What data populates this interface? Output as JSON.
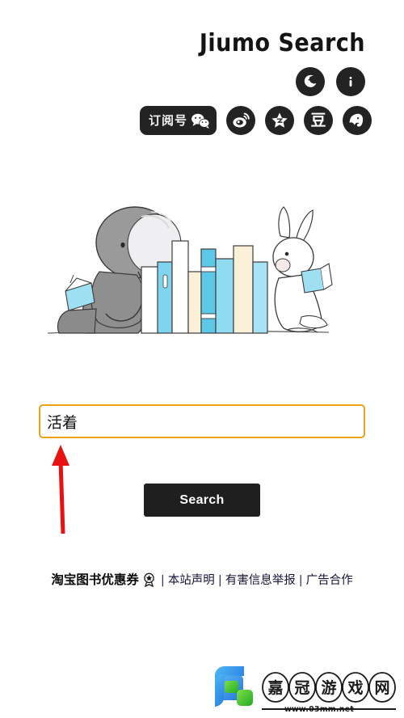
{
  "page": {
    "background_color": "#ffffff",
    "title": "Jiumo Search"
  },
  "header": {
    "brand_title": "Jiumo Search",
    "icons": [
      {
        "name": "night-mode-icon",
        "label": "☾",
        "semantic": "moon-icon"
      },
      {
        "name": "info-icon",
        "label": "i",
        "semantic": "info-icon"
      }
    ],
    "social": [
      {
        "name": "wechat-subscription",
        "label": "订阅号",
        "icon": "wechat-icon"
      },
      {
        "name": "weibo",
        "label": "",
        "icon": "weibo-icon"
      },
      {
        "name": "star-site",
        "label": "",
        "icon": "star-icon"
      },
      {
        "name": "douban",
        "label": "豆",
        "icon": "douban-icon"
      },
      {
        "name": "evernote",
        "label": "",
        "icon": "evernote-elephant-icon"
      }
    ]
  },
  "illustration": {
    "alt": "watercolor elephant and rabbit reading books",
    "colors": {
      "elephant": "#8d8d8d",
      "book_blue": "#7fd4ef",
      "book_cream": "#faf0d8",
      "outline": "#3a3a3a"
    }
  },
  "search": {
    "value": "活着",
    "placeholder": "",
    "border_color": "#e8a317",
    "button_label": "Search",
    "button_color": "#1f1f1f"
  },
  "annotation": {
    "arrow_color": "#e81212",
    "points_to": "search-input"
  },
  "footer": {
    "promo_label": "淘宝图书优惠券",
    "separator": "|",
    "links": [
      {
        "label": "本站声明"
      },
      {
        "label": "有害信息举报"
      },
      {
        "label": "广告合作"
      }
    ]
  },
  "watermark": {
    "text": "嘉冠游戏网",
    "chars": [
      "嘉",
      "冠",
      "游",
      "戏",
      "网"
    ],
    "url": "www.03mm.net",
    "logo_colors": {
      "blue": "#1f8ae8",
      "green": "#2fc42f"
    }
  }
}
